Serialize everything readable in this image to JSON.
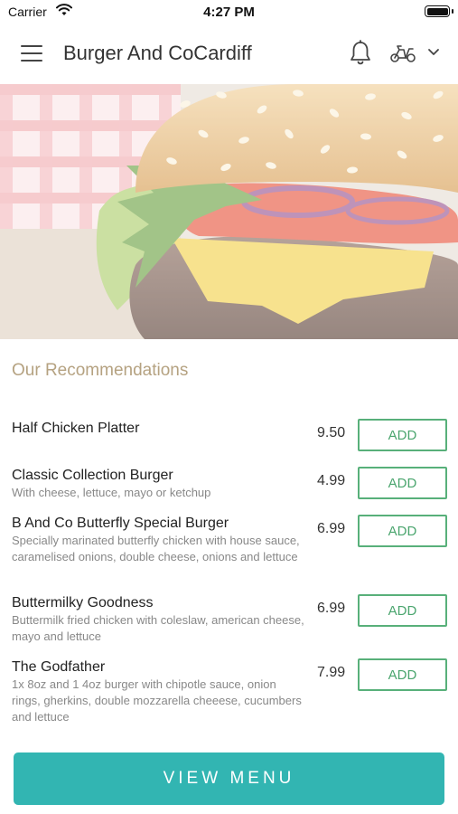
{
  "status_bar": {
    "carrier": "Carrier",
    "time": "4:27 PM"
  },
  "header": {
    "title": "Burger And CoCardiff",
    "icons": [
      "menu-icon",
      "bell-icon",
      "delivery-scooter-icon",
      "chevron-down-icon"
    ]
  },
  "hero": {
    "image": "burger-photo"
  },
  "recommendations": {
    "title": "Our Recommendations",
    "items": [
      {
        "name": "Half Chicken Platter",
        "description": "",
        "price": "9.50",
        "button": "ADD"
      },
      {
        "name": "Classic Collection Burger",
        "description": "With cheese, lettuce, mayo or ketchup",
        "price": "4.99",
        "button": "ADD"
      },
      {
        "name": "B And Co Butterfly Special Burger",
        "description": "Specially marinated butterfly chicken with house sauce, caramelised onions, double cheese, onions and lettuce",
        "price": "6.99",
        "button": "ADD"
      },
      {
        "name": "Buttermilky Goodness",
        "description": "Buttermilk fried chicken with coleslaw, american cheese, mayo and lettuce",
        "price": "6.99",
        "button": "ADD"
      },
      {
        "name": "The Godfather",
        "description": "1x 8oz and 1 4oz burger with chipotle sauce, onion rings, gherkins, double mozzarella cheeese, cucumbers and lettuce",
        "price": "7.99",
        "button": "ADD"
      }
    ]
  },
  "footer": {
    "view_menu_label": "VIEW MENU"
  },
  "colors": {
    "accent": "#32b5b2",
    "add_green": "#4aa56e",
    "section_title": "#b5a281"
  }
}
